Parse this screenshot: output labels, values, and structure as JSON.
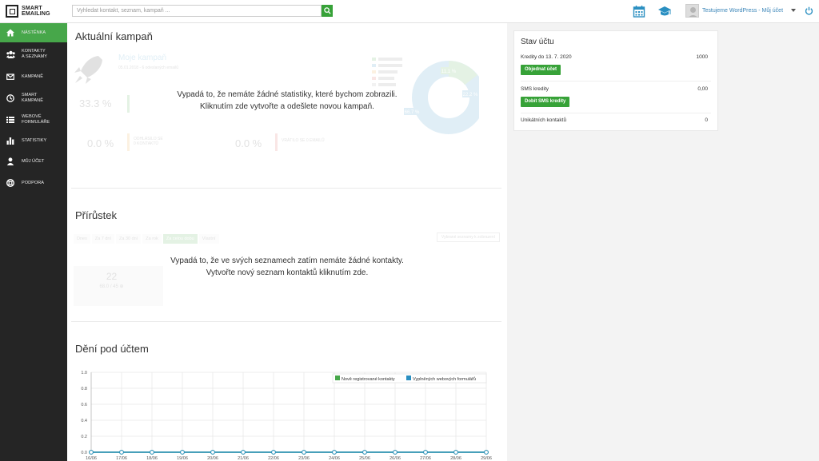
{
  "brand": {
    "line1": "SMART",
    "line2": "EMAILING"
  },
  "search": {
    "placeholder": "Vyhledat kontakt, seznam, kampaň ..."
  },
  "header": {
    "user_label": "Testujeme WordPress - Můj účet"
  },
  "sidebar": {
    "items": [
      {
        "label1": "Nástěnka",
        "label2": "",
        "icon": "home-icon",
        "active": true
      },
      {
        "label1": "Kontakty",
        "label2": "a seznamy",
        "icon": "users-icon"
      },
      {
        "label1": "Kampaně",
        "label2": "",
        "icon": "envelope-icon"
      },
      {
        "label1": "Smart",
        "label2": "kampaně",
        "icon": "clock-icon"
      },
      {
        "label1": "Webové",
        "label2": "formuláře",
        "icon": "list-icon"
      },
      {
        "label1": "Statistiky",
        "label2": "",
        "icon": "bar-chart-icon"
      },
      {
        "label1": "Můj účet",
        "label2": "",
        "icon": "user-icon"
      },
      {
        "label1": "Podpora",
        "label2": "",
        "icon": "lifebuoy-icon"
      }
    ]
  },
  "campaigns": {
    "title": "Aktuální kampaň",
    "empty_line1": "Vypadá to, že nemáte žádné statistiky, které bychom zobrazili.",
    "empty_line2": "Kliknutím zde vytvořte a odešlete novou kampaň.",
    "ghost": {
      "campaign_name": "Moje kampaň",
      "campaign_meta": "05.01.2018 - 6 odeslaných emailů",
      "stat1": "33.3 %",
      "stat2": "0.0 %",
      "stat3": "0.0 %",
      "pct_a": "11.1 %",
      "pct_b": "22.2 %",
      "pct_c": "66.7 %",
      "label_bounced": "ODHLÁSILO SE\n0 KONTAKTŮ",
      "label_returned": "VRÁTILO SE 0 EMAILŮ"
    }
  },
  "growth": {
    "title": "Přírůstek",
    "tabs": [
      "Dnes",
      "Za 7 dní",
      "Za 30 dní",
      "Za rok",
      "Za celou dobu",
      "Vlastní"
    ],
    "filter": "Vybrané seznamy k zobrazení",
    "empty_line1": "Vypadá to, že ve svých seznamech zatím nemáte žádné kontakty.",
    "empty_line2": "Vytvořte nový seznam kontaktů kliknutím zde.",
    "ghost": {
      "count": "22",
      "sub": "68.0 / 45 ⊕"
    }
  },
  "activity": {
    "title": "Dění pod účtem",
    "legend": [
      {
        "label": "Nově registrované kontakty",
        "color": "#47a74a"
      },
      {
        "label": "Vyplněných webových formulářů",
        "color": "#2a8fc1"
      }
    ]
  },
  "account": {
    "title": "Stav účtu",
    "credits_label": "Kredity do 13. 7. 2020",
    "credits_value": "1000",
    "order_button": "Objednat účet",
    "sms_label": "SMS kredity",
    "sms_value": "0,00",
    "sms_button": "Dobít SMS kredity",
    "unique_label": "Unikátních kontaktů",
    "unique_value": "0"
  },
  "chart_data": {
    "type": "line",
    "categories": [
      "16/06",
      "17/06",
      "18/06",
      "19/06",
      "20/06",
      "21/06",
      "22/06",
      "23/06",
      "24/06",
      "25/06",
      "26/06",
      "27/06",
      "28/06",
      "29/06"
    ],
    "series": [
      {
        "name": "Nově registrované kontakty",
        "values": [
          0,
          0,
          0,
          0,
          0,
          0,
          0,
          0,
          0,
          0,
          0,
          0,
          0,
          0
        ],
        "color": "#47a74a"
      },
      {
        "name": "Vyplněných webových formulářů",
        "values": [
          0,
          0,
          0,
          0,
          0,
          0,
          0,
          0,
          0,
          0,
          0,
          0,
          0,
          0
        ],
        "color": "#2a8fc1"
      }
    ],
    "yticks": [
      "1.0",
      "0.8",
      "0.6",
      "0.4",
      "0.2",
      "0.0"
    ],
    "ylim": [
      0,
      1
    ],
    "grid": true,
    "legend_position": "top-right"
  }
}
